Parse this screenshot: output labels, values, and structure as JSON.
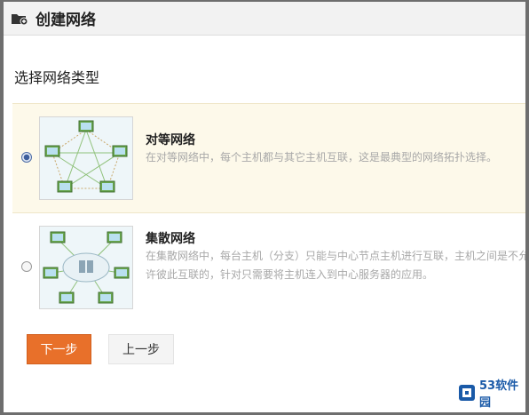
{
  "dialog": {
    "title": "创建网络",
    "title_icon": "folder-plus-icon"
  },
  "section_title": "选择网络类型",
  "options": [
    {
      "title": "对等网络",
      "description": "在对等网络中，每个主机都与其它主机互联，这是最典型的网络拓扑选择。",
      "selected": true,
      "icon": "peer-network-diagram-icon"
    },
    {
      "title": "集散网络",
      "description": "在集散网络中，每台主机（分支）只能与中心节点主机进行互联，主机之间是不允许彼此互联的，针对只需要将主机连入到中心服务器的应用。",
      "selected": false,
      "icon": "hub-network-diagram-icon"
    }
  ],
  "buttons": {
    "next": "下一步",
    "prev": "上一步"
  },
  "watermark": {
    "text": "53软件园"
  },
  "colors": {
    "accent": "#e8702a",
    "selected_bg": "#fdf9ea",
    "radio_checked": "#3d5e9c",
    "watermark": "#1a5aa8"
  }
}
